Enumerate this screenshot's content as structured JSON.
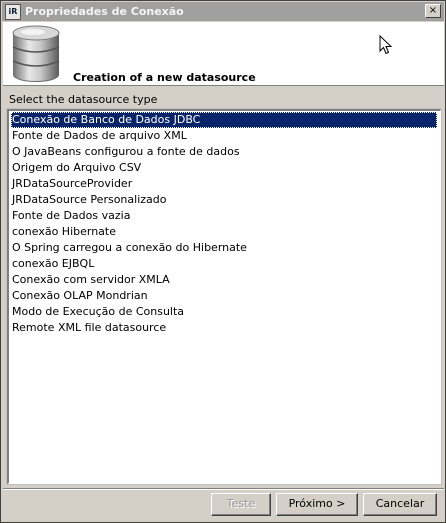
{
  "window": {
    "title": "Propriedades de Conexão",
    "close_label": "×"
  },
  "header": {
    "title": "Creation of a new datasource",
    "icon": "database-icon"
  },
  "section_label": "Select the datasource type",
  "datasource_types": [
    {
      "label": "Conexão de Banco de Dados JDBC",
      "selected": true
    },
    {
      "label": "Fonte de Dados de arquivo XML",
      "selected": false
    },
    {
      "label": "O JavaBeans configurou a fonte de dados",
      "selected": false
    },
    {
      "label": "Origem do Arquivo CSV",
      "selected": false
    },
    {
      "label": "JRDataSourceProvider",
      "selected": false
    },
    {
      "label": "JRDataSource Personalizado",
      "selected": false
    },
    {
      "label": "Fonte de Dados vazia",
      "selected": false
    },
    {
      "label": "conexão Hibernate",
      "selected": false
    },
    {
      "label": "O Spring carregou a conexão do Hibernate",
      "selected": false
    },
    {
      "label": "conexão EJBQL",
      "selected": false
    },
    {
      "label": "Conexão com servidor XMLA",
      "selected": false
    },
    {
      "label": "Conexão OLAP Mondrian",
      "selected": false
    },
    {
      "label": "Modo de Execução de Consulta",
      "selected": false
    },
    {
      "label": "Remote XML file datasource",
      "selected": false
    }
  ],
  "buttons": {
    "test": "Teste",
    "next": "Próximo >",
    "cancel": "Cancelar"
  },
  "colors": {
    "selection": "#0a246a",
    "dialog_bg": "#d4d0c8",
    "titlebar": "#a0a0a0"
  }
}
